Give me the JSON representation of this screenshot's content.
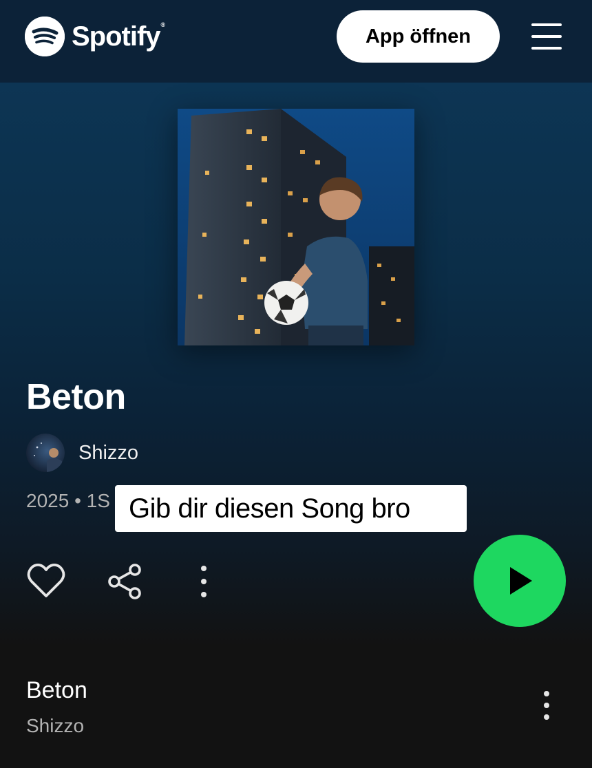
{
  "header": {
    "brand": "Spotify",
    "brand_mark": "®",
    "open_app_label": "App öffnen",
    "logo_icon": "spotify-logo-icon",
    "menu_icon": "hamburger-menu-icon"
  },
  "release": {
    "title": "Beton",
    "artist": "Shizzo",
    "meta_visible": "2025 • 1S",
    "cover_icon": "album-cover-image"
  },
  "overlay": {
    "caption": "Gib dir diesen Song bro"
  },
  "actions": {
    "like_icon": "heart-icon",
    "share_icon": "share-icon",
    "more_icon": "more-vertical-icon",
    "play_icon": "play-icon"
  },
  "tracks": [
    {
      "title": "Beton",
      "artist": "Shizzo"
    }
  ],
  "colors": {
    "accent_green": "#1ed760",
    "header_bg": "#0c2238",
    "hero_top": "#0d3554",
    "page_bg": "#121212",
    "muted_text": "#b3b3b3"
  }
}
